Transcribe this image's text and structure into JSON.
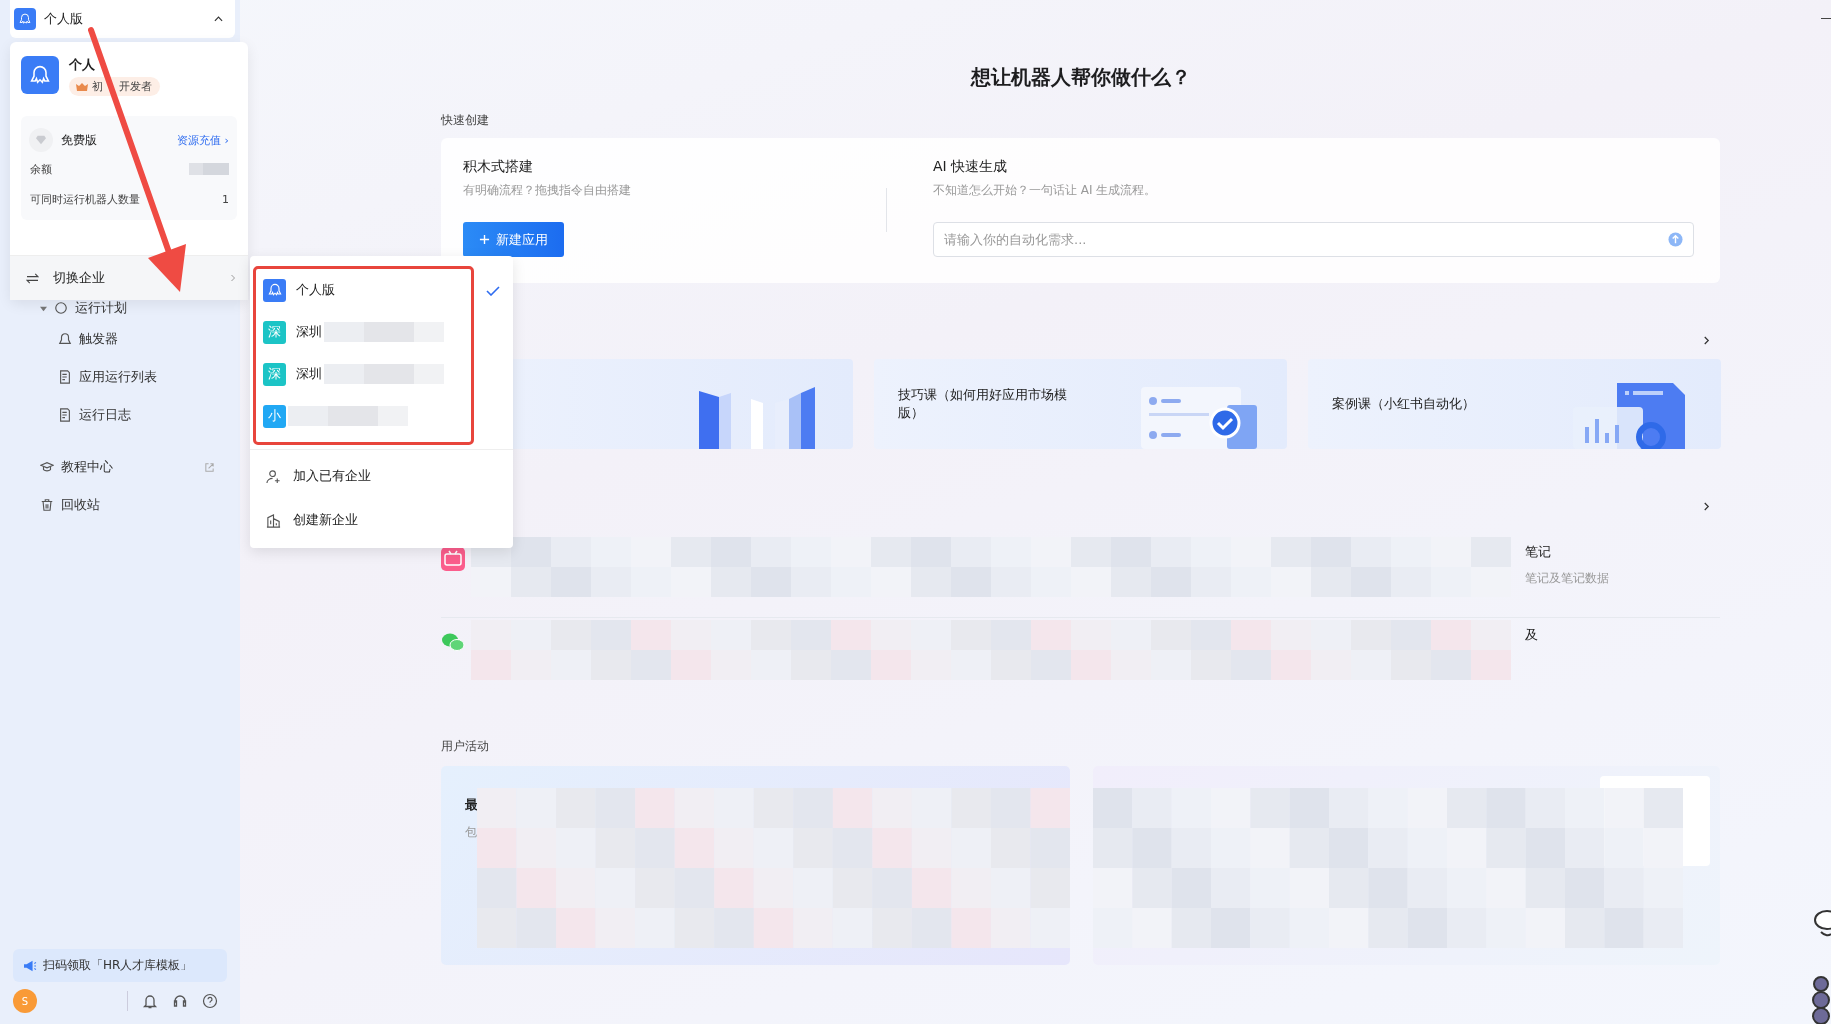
{
  "workspace_selector": {
    "label": "个人版",
    "expanded": true
  },
  "account_menu": {
    "name": "个人",
    "badge_parts": [
      "初",
      "开发者"
    ],
    "plan": "免费版",
    "recharge_link": "资源充值 ›",
    "stats": [
      {
        "label": "余额"
      },
      {
        "label": "可同时运行机器人数量",
        "value": "1"
      }
    ],
    "switch_label": "切换企业"
  },
  "organizations": [
    {
      "kind": "logo",
      "name": "个人版",
      "color": "#3a7cf6",
      "selected": true
    },
    {
      "kind": "letter",
      "avatar": "深",
      "name": "深圳",
      "color": "#1cc4c6",
      "selected": false
    },
    {
      "kind": "letter",
      "avatar": "深",
      "name": "深圳",
      "color": "#1cc4c6",
      "selected": false
    },
    {
      "kind": "letter",
      "avatar": "小",
      "color": "#21a8f4",
      "selected": false
    }
  ],
  "org_actions": [
    {
      "kind": "join",
      "label": "加入已有企业"
    },
    {
      "kind": "create",
      "label": "创建新企业"
    }
  ],
  "sidebar": {
    "items": [
      {
        "label": "运行计划",
        "kind": "clock",
        "expanded": true,
        "children": [
          {
            "label": "触发器",
            "kind": "trigger"
          },
          {
            "label": "应用运行列表",
            "kind": "list"
          },
          {
            "label": "运行日志",
            "kind": "log"
          }
        ]
      },
      {
        "label": "教程中心",
        "kind": "tutorial",
        "external": true
      },
      {
        "label": "回收站",
        "kind": "trash",
        "external": false
      }
    ],
    "banner": "扫码领取「HR人才库模板」",
    "avatar": "S"
  },
  "main": {
    "title": "想让机器人帮你做什么？",
    "quick_create": {
      "heading": "快速创建",
      "builder": {
        "title": "积木式搭建",
        "subtitle": "有明确流程？拖拽指令自由搭建",
        "button": "新建应用"
      },
      "ai": {
        "title": "AI 快速生成",
        "subtitle": "不知道怎么开始？一句话让 AI 生成流程。",
        "placeholder": "请输入你的自动化需求..."
      }
    },
    "courses": [
      {
        "kind": "books"
      },
      {
        "kind": "checklist",
        "title": "技巧课（如何用好应用市场模版）"
      },
      {
        "kind": "chart",
        "title": "案例课（小红书自动化）"
      }
    ],
    "templates": [
      {
        "kind": "video",
        "title": "笔记",
        "subtitle": "笔记及笔记数据"
      },
      {
        "kind": "chat",
        "title": "及"
      }
    ],
    "activity": {
      "heading": "用户活动",
      "cards": [
        {
          "kind": "text",
          "title": "最",
          "subtitle": "包"
        },
        {
          "kind": "preview"
        }
      ]
    }
  }
}
